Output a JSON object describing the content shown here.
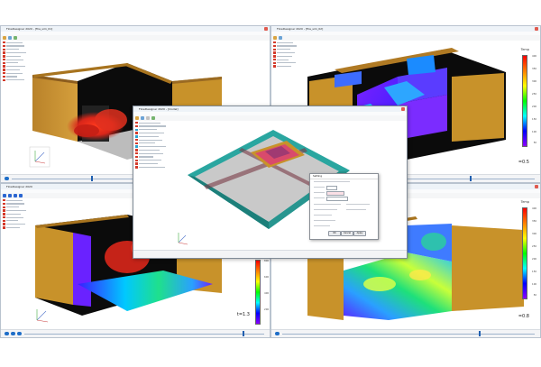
{
  "windows": {
    "top_left": {
      "title": "FlowDesigner 2020 - [fire_sim_01]",
      "time_label": "",
      "colorbar_title": ""
    },
    "top_right": {
      "title": "FlowDesigner 2020 - [fire_sim_02]",
      "time_label": "=0.5",
      "colorbar_title": "Temp",
      "colorbar_ticks": [
        "400",
        "350",
        "300",
        "250",
        "200",
        "150",
        "100",
        "50"
      ]
    },
    "bottom_left": {
      "title": "FlowDesigner 2020",
      "time_label": "t=1.3",
      "colorbar_ticks": [
        "800",
        "600",
        "400",
        "200"
      ]
    },
    "bottom_right": {
      "title": "FlowDesigner 2020",
      "time_label": "=0.8",
      "colorbar_title": "Temp",
      "colorbar_ticks": [
        "400",
        "350",
        "300",
        "250",
        "200",
        "150",
        "100",
        "50"
      ]
    },
    "center": {
      "title": "FlowDesigner 2020 - [model]"
    }
  },
  "dialog": {
    "title": "Setting",
    "ok_label": "OK",
    "cancel_label": "Cancel",
    "apply_label": "Apply"
  },
  "colors": {
    "accent": "#1e6ec8",
    "wall": "#c8922a",
    "fire": "#e2311f",
    "floor": "#c9c9c9",
    "teal": "#2aa6a0"
  },
  "icons": [
    "play-icon",
    "tree-folder-icon",
    "axes-icon",
    "window-close-icon"
  ]
}
